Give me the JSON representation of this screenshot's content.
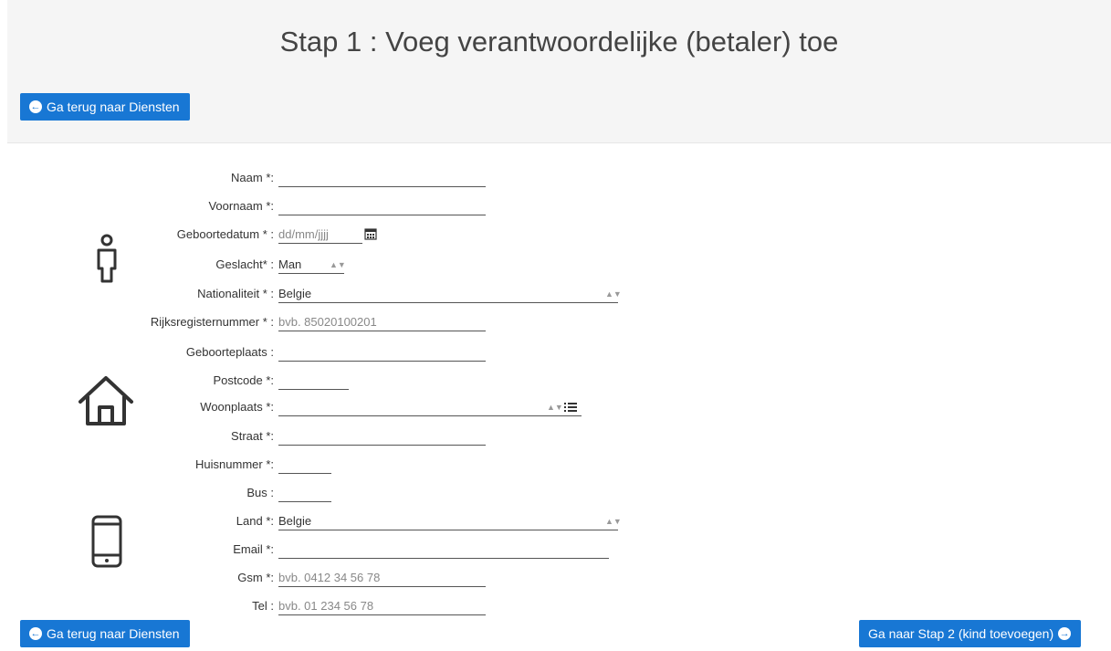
{
  "header": {
    "title": "Stap 1 : Voeg verantwoordelijke (betaler) toe",
    "back_button": "Ga terug naar Diensten"
  },
  "form": {
    "naam": {
      "label": "Naam *:",
      "value": ""
    },
    "voornaam": {
      "label": "Voornaam *:",
      "value": ""
    },
    "geboortedatum": {
      "label": "Geboortedatum * :",
      "placeholder": "dd/mm/jjjj"
    },
    "geslacht": {
      "label": "Geslacht* :",
      "value": "Man"
    },
    "nationaliteit": {
      "label": "Nationaliteit * :",
      "value": "Belgie"
    },
    "rijksregister": {
      "label": "Rijksregisternummer * :",
      "placeholder": "bvb. 85020100201"
    },
    "geboorteplaats": {
      "label": "Geboorteplaats :",
      "value": ""
    },
    "postcode": {
      "label": "Postcode *:",
      "value": ""
    },
    "woonplaats": {
      "label": "Woonplaats *:",
      "value": ""
    },
    "straat": {
      "label": "Straat *:",
      "value": ""
    },
    "huisnummer": {
      "label": "Huisnummer *:",
      "value": ""
    },
    "bus": {
      "label": "Bus :",
      "value": ""
    },
    "land": {
      "label": "Land *:",
      "value": "Belgie"
    },
    "email": {
      "label": "Email *:",
      "value": ""
    },
    "gsm": {
      "label": "Gsm *:",
      "placeholder": "bvb. 0412 34 56 78"
    },
    "tel": {
      "label": "Tel :",
      "placeholder": "bvb. 01 234 56 78"
    }
  },
  "footer": {
    "back_button": "Ga terug naar Diensten",
    "next_button": "Ga naar Stap 2 (kind toevoegen)"
  },
  "icons": [
    "person-icon",
    "house-icon",
    "phone-icon",
    "calendar-icon",
    "list-icon",
    "arrow-left-circle-icon",
    "arrow-right-circle-icon"
  ],
  "colors": {
    "primary": "#1877d4",
    "header_bg": "#f5f5f5"
  }
}
